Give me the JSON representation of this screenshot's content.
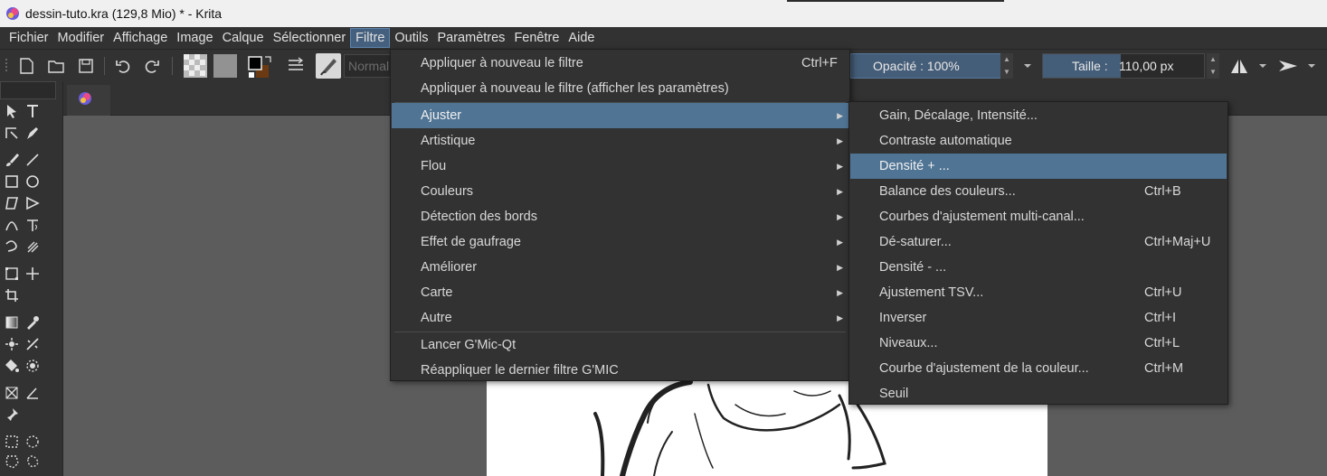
{
  "window": {
    "title": "dessin-tuto.kra (129,8 Mio)  * - Krita"
  },
  "menubar": {
    "items": [
      {
        "label": "Fichier"
      },
      {
        "label": "Modifier"
      },
      {
        "label": "Affichage"
      },
      {
        "label": "Image"
      },
      {
        "label": "Calque"
      },
      {
        "label": "Sélectionner"
      },
      {
        "label": "Filtre",
        "active": true
      },
      {
        "label": "Outils"
      },
      {
        "label": "Paramètres"
      },
      {
        "label": "Fenêtre"
      },
      {
        "label": "Aide"
      }
    ]
  },
  "toolbar": {
    "blend_mode": "Normal",
    "opacity_label": "Opacité : 100%",
    "size_label": "Taille :",
    "size_value": "110,00 px",
    "icons": [
      "new-document-icon",
      "open-icon",
      "save-icon",
      "undo-icon",
      "redo-icon",
      "fill-gradient-icon",
      "pattern-icon",
      "color-swap-icon",
      "layers-icon",
      "brush-preset-icon",
      "mirror-h-icon",
      "mirror-v-icon"
    ],
    "colors": {
      "foreground": "#000000",
      "background": "#6b3a12",
      "accent": "#445d78"
    }
  },
  "filter_menu": {
    "items": [
      {
        "label": "Appliquer à nouveau le filtre",
        "shortcut": "Ctrl+F"
      },
      {
        "label": "Appliquer à nouveau le filtre (afficher les paramètres)",
        "shortcut": ""
      },
      {
        "label": "Ajuster",
        "submenu": true,
        "highlighted": true
      },
      {
        "label": "Artistique",
        "submenu": true
      },
      {
        "label": "Flou",
        "submenu": true
      },
      {
        "label": "Couleurs",
        "submenu": true
      },
      {
        "label": "Détection des bords",
        "submenu": true
      },
      {
        "label": "Effet de gaufrage",
        "submenu": true
      },
      {
        "label": "Améliorer",
        "submenu": true
      },
      {
        "label": "Carte",
        "submenu": true
      },
      {
        "label": "Autre",
        "submenu": true
      },
      {
        "label": "Lancer G'Mic-Qt",
        "shortcut": ""
      },
      {
        "label": "Réappliquer le dernier filtre G'MIC",
        "shortcut": ""
      }
    ]
  },
  "adjust_menu": {
    "items": [
      {
        "label": "Gain, Décalage, Intensité...",
        "shortcut": ""
      },
      {
        "label": "Contraste automatique",
        "shortcut": ""
      },
      {
        "label": "Densité + ...",
        "shortcut": "",
        "highlighted": true
      },
      {
        "label": "Balance des couleurs...",
        "shortcut": "Ctrl+B"
      },
      {
        "label": "Courbes d'ajustement multi-canal...",
        "shortcut": ""
      },
      {
        "label": "Dé-saturer...",
        "shortcut": "Ctrl+Maj+U"
      },
      {
        "label": "Densité - ...",
        "shortcut": ""
      },
      {
        "label": "Ajustement TSV...",
        "shortcut": "Ctrl+U"
      },
      {
        "label": "Inverser",
        "shortcut": "Ctrl+I"
      },
      {
        "label": "Niveaux...",
        "shortcut": "Ctrl+L"
      },
      {
        "label": "Courbe d'ajustement de la couleur...",
        "shortcut": "Ctrl+M"
      },
      {
        "label": "Seuil",
        "shortcut": ""
      }
    ]
  },
  "toolbox": {
    "tools": [
      "select-shapes-icon",
      "text-icon",
      "edit-shapes-icon",
      "calligraphy-icon",
      "brush-icon",
      "line-icon",
      "rectangle-icon",
      "ellipse-icon",
      "polygon-icon",
      "polyline-icon",
      "bezier-icon",
      "freehand-path-icon",
      "dynamic-brush-icon",
      "multibrush-icon",
      "transform-icon",
      "move-icon",
      "crop-icon",
      "gradient-icon",
      "color-picker-icon",
      "smart-patch-icon",
      "assistant-icon",
      "fill-icon",
      "enclose-fill-icon",
      "measure-icon",
      "reference-icon",
      "rect-select-icon",
      "ellipse-select-icon",
      "polygon-select-icon",
      "freehand-select-icon"
    ]
  }
}
